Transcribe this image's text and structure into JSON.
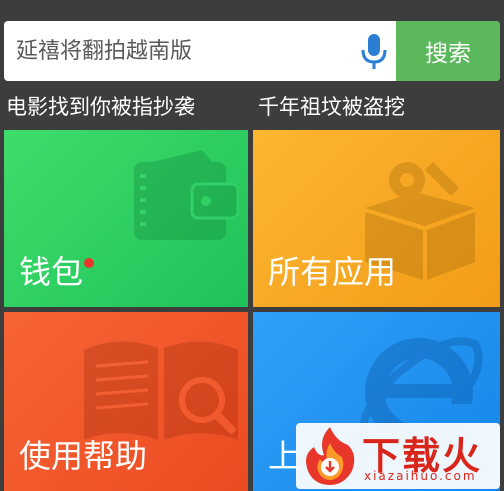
{
  "search": {
    "placeholder": "延禧将翻拍越南版",
    "button_label": "搜索",
    "mic_icon": "microphone-icon"
  },
  "hot_searches": [
    "电影找到你被指抄袭",
    "千年祖坟被盗挖"
  ],
  "tiles": [
    {
      "label": "钱包",
      "icon": "wallet-icon",
      "color": "#2ecc5e"
    },
    {
      "label": "所有应用",
      "icon": "gift-box-gear-icon",
      "color": "#f5a623"
    },
    {
      "label": "使用帮助",
      "icon": "book-magnifier-icon",
      "color": "#f0552a"
    },
    {
      "label": "上",
      "icon": "internet-explorer-icon",
      "color": "#1e90f0"
    }
  ],
  "watermark": {
    "brand": "下载火",
    "domain": "xiazaihuo.com"
  },
  "colors": {
    "search_button": "#5cb85c",
    "mic": "#2a7fd4",
    "badge": "#e8362a"
  }
}
